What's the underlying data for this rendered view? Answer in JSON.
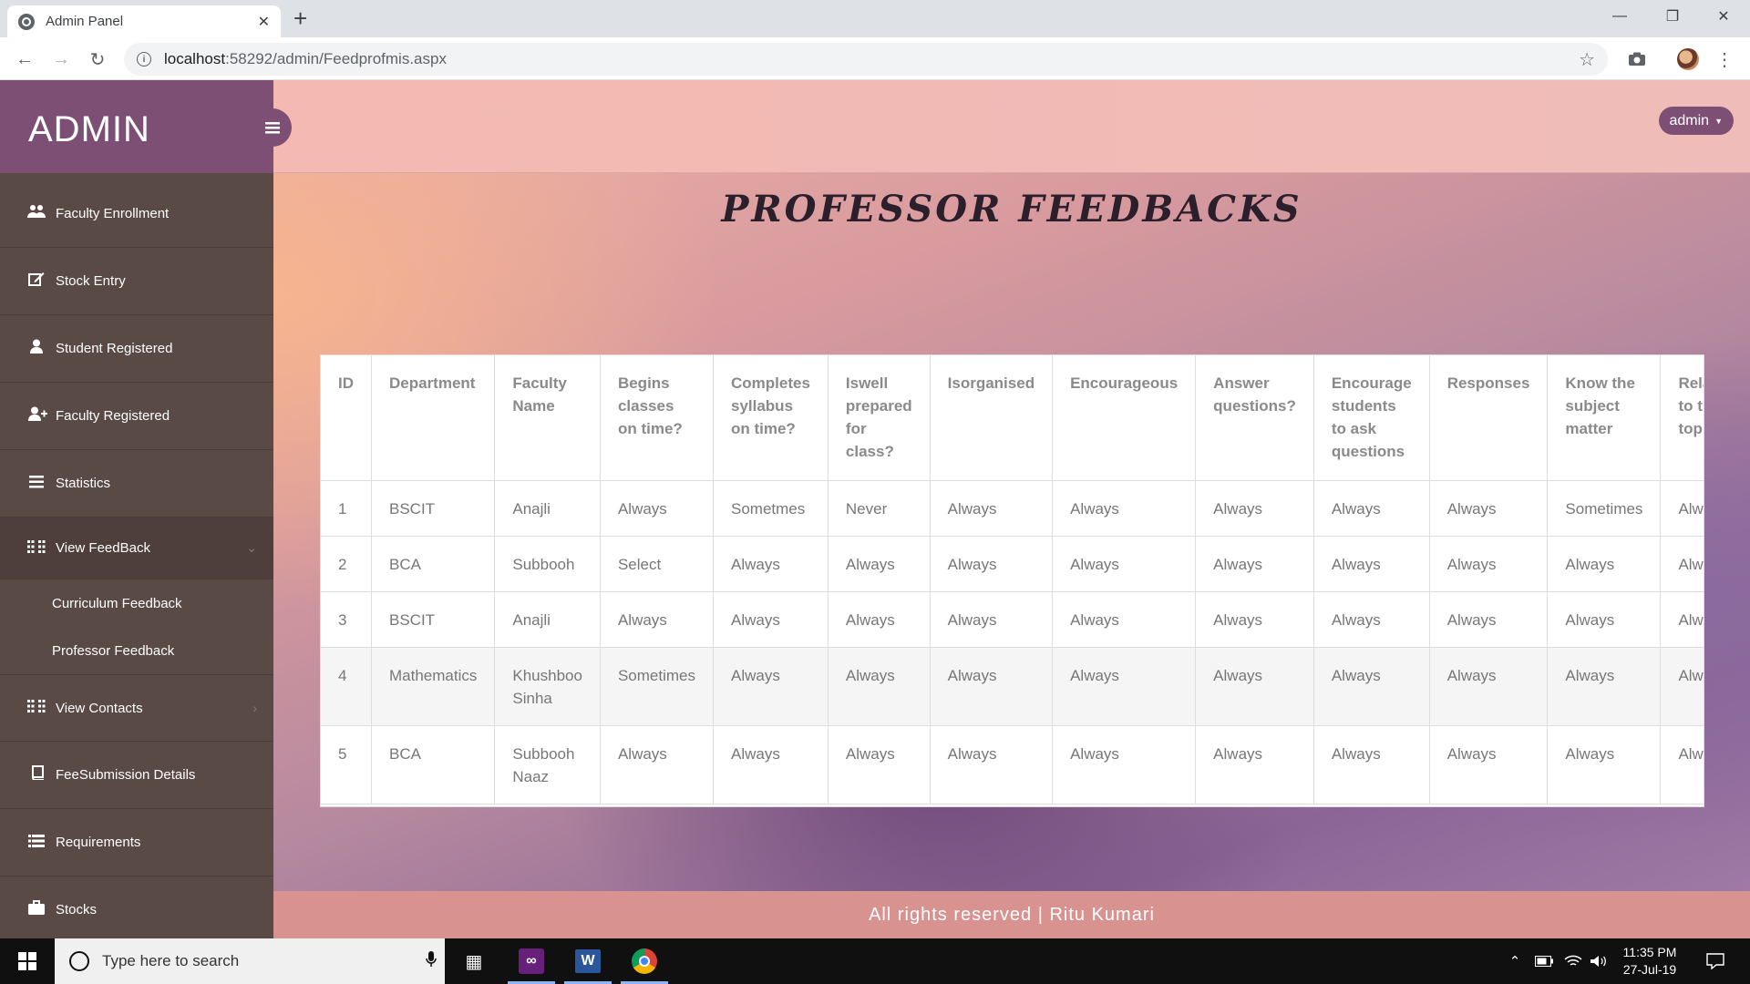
{
  "browser": {
    "tab_title": "Admin Panel",
    "url_host": "localhost",
    "url_path": ":58292/admin/Feedprofmis.aspx"
  },
  "sidebar": {
    "brand": "ADMIN",
    "items": [
      {
        "label": "Faculty Enrollment",
        "icon": "users-icon"
      },
      {
        "label": "Stock Entry",
        "icon": "edit-icon"
      },
      {
        "label": "Student Registered",
        "icon": "user-icon"
      },
      {
        "label": "Faculty Registered",
        "icon": "user-plus-icon"
      },
      {
        "label": "Statistics",
        "icon": "list-icon"
      },
      {
        "label": "View FeedBack",
        "icon": "grid-icon"
      },
      {
        "label": "View Contacts",
        "icon": "grid-icon"
      },
      {
        "label": "FeeSubmission Details",
        "icon": "book-icon"
      },
      {
        "label": "Requirements",
        "icon": "list-alt-icon"
      },
      {
        "label": "Stocks",
        "icon": "briefcase-icon"
      }
    ],
    "feedback_subitems": [
      "Curriculum Feedback",
      "Professor Feedback"
    ]
  },
  "topbar": {
    "user_button": "admin"
  },
  "main": {
    "title": "PROFESSOR FEEDBACKS",
    "table": {
      "headers": [
        "ID",
        "Department",
        "Faculty Name",
        "Begins classes on time?",
        "Completes syllabus on time?",
        "Iswell prepared for class?",
        "Isorganised",
        "Encourageous",
        "Answer questions?",
        "Encourage students to ask questions",
        "Responses",
        "Know the subject matter",
        "Relates to the topic"
      ],
      "rows": [
        [
          "1",
          "BSCIT",
          "Anajli",
          "Always",
          "Sometmes",
          "Never",
          "Always",
          "Always",
          "Always",
          "Always",
          "Always",
          "Sometimes",
          "Always"
        ],
        [
          "2",
          "BCA",
          "Subbooh",
          "Select",
          "Always",
          "Always",
          "Always",
          "Always",
          "Always",
          "Always",
          "Always",
          "Always",
          "Always"
        ],
        [
          "3",
          "BSCIT",
          "Anajli",
          "Always",
          "Always",
          "Always",
          "Always",
          "Always",
          "Always",
          "Always",
          "Always",
          "Always",
          "Always"
        ],
        [
          "4",
          "Mathematics",
          "Khushboo Sinha",
          "Sometimes",
          "Always",
          "Always",
          "Always",
          "Always",
          "Always",
          "Always",
          "Always",
          "Always",
          "Always"
        ],
        [
          "5",
          "BCA",
          "Subbooh Naaz",
          "Always",
          "Always",
          "Always",
          "Always",
          "Always",
          "Always",
          "Always",
          "Always",
          "Always",
          "Always"
        ]
      ]
    }
  },
  "footer": {
    "text": "All rights reserved | Ritu Kumari"
  },
  "taskbar": {
    "search_placeholder": "Type here to search",
    "time": "11:35 PM",
    "date": "27-Jul-19"
  }
}
